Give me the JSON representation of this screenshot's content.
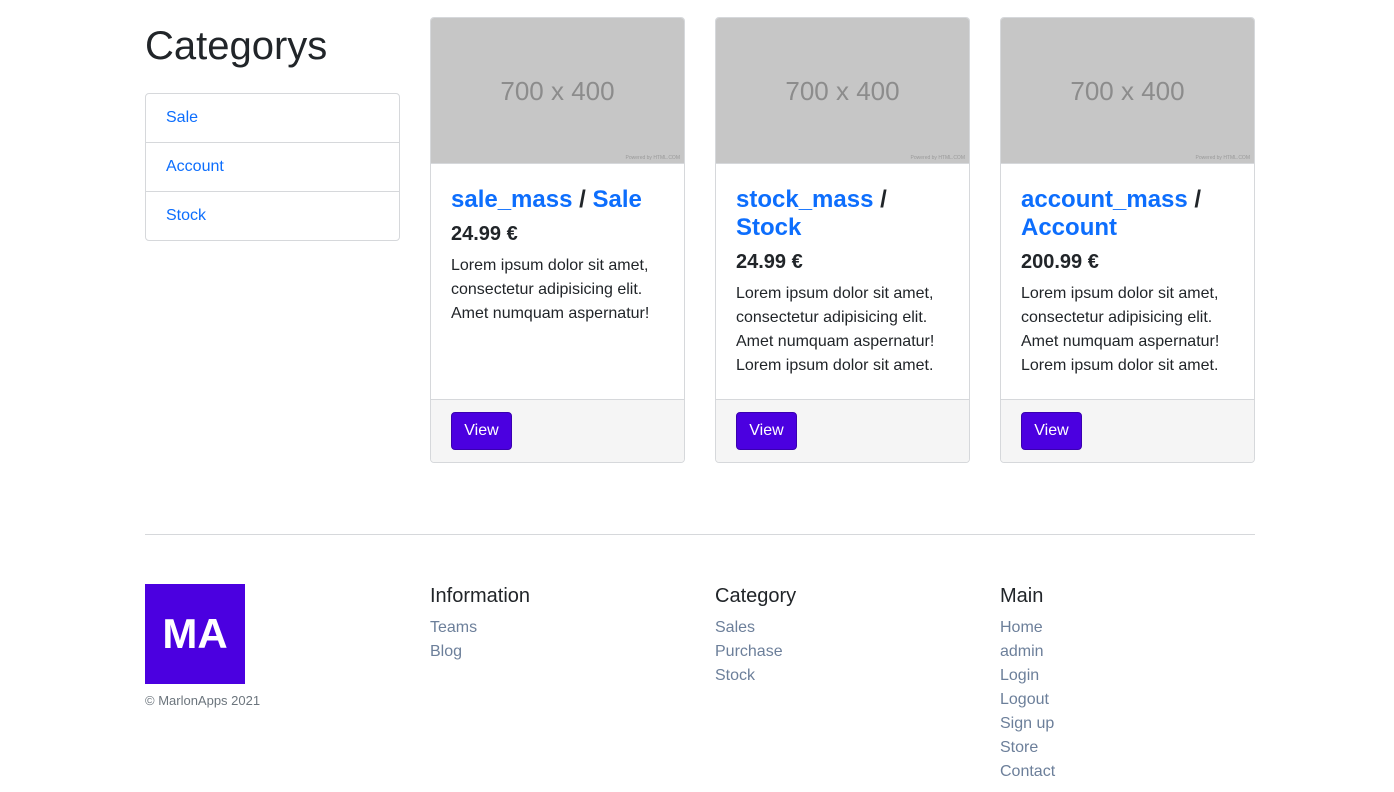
{
  "sidebar": {
    "title": "Categorys",
    "categories": [
      "Sale",
      "Account",
      "Stock"
    ]
  },
  "products": [
    {
      "name": "sale_mass",
      "separator": "/",
      "category": "Sale",
      "price": "24.99 €",
      "description": "Lorem ipsum dolor sit amet, consectetur adipisicing elit. Amet numquam aspernatur!",
      "image_label": "700 x 400",
      "image_credit": "Powered by HTML.COM",
      "button_label": "View"
    },
    {
      "name": "stock_mass",
      "separator": "/",
      "category": "Stock",
      "price": "24.99 €",
      "description": "Lorem ipsum dolor sit amet, consectetur adipisicing elit. Amet numquam aspernatur! Lorem ipsum dolor sit amet.",
      "image_label": "700 x 400",
      "image_credit": "Powered by HTML.COM",
      "button_label": "View"
    },
    {
      "name": "account_mass",
      "separator": "/",
      "category": "Account",
      "price": "200.99 €",
      "description": "Lorem ipsum dolor sit amet, consectetur adipisicing elit. Amet numquam aspernatur! Lorem ipsum dolor sit amet.",
      "image_label": "700 x 400",
      "image_credit": "Powered by HTML.COM",
      "button_label": "View"
    }
  ],
  "footer": {
    "logo_text": "MA",
    "copyright": "© MarlonApps 2021",
    "columns": [
      {
        "heading": "Information",
        "links": [
          "Teams",
          "Blog"
        ]
      },
      {
        "heading": "Category",
        "links": [
          "Sales",
          "Purchase",
          "Stock"
        ]
      },
      {
        "heading": "Main",
        "links": [
          "Home",
          "admin",
          "Login",
          "Logout",
          "Sign up",
          "Store",
          "Contact"
        ]
      }
    ]
  },
  "colors": {
    "link": "#0d6efd",
    "button": "#4b00e0",
    "footer_link": "#6c7f9a",
    "placeholder": "#c6c6c6"
  }
}
